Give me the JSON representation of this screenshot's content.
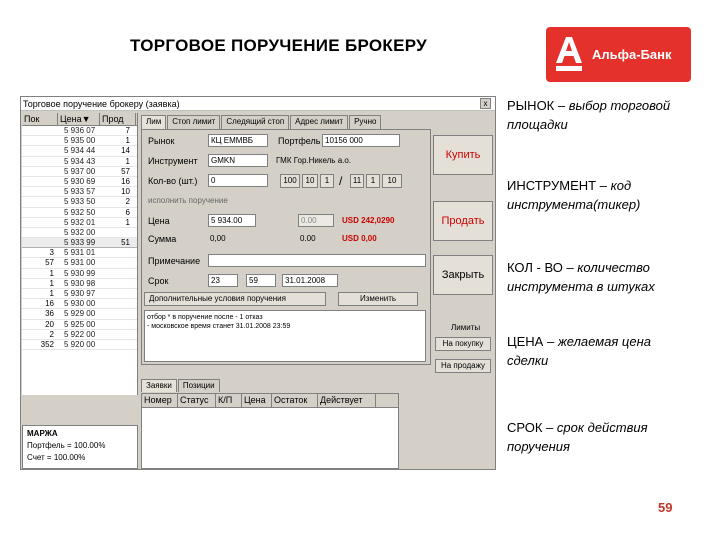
{
  "slide": {
    "title": "ТОРГОВОЕ ПОРУЧЕНИЕ БРОКЕРУ",
    "logo_text": "Альфа-Банк",
    "logo_letter": "А",
    "page_number": "59"
  },
  "window": {
    "title": "Торговое поручение брокеру (заявка)",
    "close": "x"
  },
  "quotes": {
    "headers": [
      "Пок",
      "Цена▼",
      "Прод"
    ],
    "rows": [
      [
        "",
        "5 936 07",
        "7"
      ],
      [
        "",
        "5 935 00",
        "1"
      ],
      [
        "",
        "5 934 44",
        "14"
      ],
      [
        "",
        "5 934 43",
        "1"
      ],
      [
        "",
        "5 937 00",
        "57"
      ],
      [
        "",
        "5 930 69",
        "16"
      ],
      [
        "",
        "5 933 57",
        "10"
      ],
      [
        "",
        "5 933 50",
        "2"
      ],
      [
        "",
        "5 932 50",
        "6"
      ],
      [
        "",
        "5 932 01",
        "1"
      ],
      [
        "",
        "5 932 00",
        ""
      ],
      [
        "",
        "5 933 99",
        "51"
      ],
      [
        "3",
        "5 931 01",
        ""
      ],
      [
        "57",
        "5 931 00",
        ""
      ],
      [
        "1",
        "5 930 99",
        ""
      ],
      [
        "1",
        "5 930 98",
        ""
      ],
      [
        "1",
        "5 930 97",
        ""
      ],
      [
        "16",
        "5 930 00",
        ""
      ],
      [
        "36",
        "5 929 00",
        ""
      ],
      [
        "20",
        "5 925 00",
        ""
      ],
      [
        "2",
        "5 922 00",
        ""
      ],
      [
        "352",
        "5 920 00",
        ""
      ]
    ]
  },
  "margin": {
    "label": "МАРЖА",
    "portfolio": "Портфель = 100.00%",
    "account": "Счет = 100.00%"
  },
  "tabs": [
    "Лим",
    "Стоп лимит",
    "Следящий стоп",
    "Адрес лимит",
    "Ручно"
  ],
  "form": {
    "market_label": "Рынок",
    "market_value": "КЦ ЕММВБ",
    "portfolio_label": "Портфель",
    "portfolio_value": "10156 000",
    "instrument_label": "Инструмент",
    "instrument_value": "GMKN",
    "instrument_name": "ГМК Гор.Никель а.о.",
    "qty_label": "Кол-во (шт.)",
    "qty_value": "0",
    "qty_steps": [
      "100",
      "10",
      "1",
      "/",
      "11",
      "1",
      "10"
    ],
    "checkbox_label": "исполнить поручение",
    "price_label": "Цена",
    "price_value": "5 934.00",
    "price_extra": "0.00",
    "price_usd": "USD 242,0290",
    "sum_label": "Сумма",
    "sum_value": "0,00",
    "sum_extra": "0.00",
    "sum_usd": "USD 0,00",
    "note_label": "Примечание",
    "term_label": "Срок",
    "term_hour": "23",
    "term_min": "59",
    "term_date": "31.01.2008",
    "extra_label": "Дополнительные условия поручения",
    "change_btn": "Изменить",
    "info_line1": "отбор * в поручение после - 1 отказ",
    "info_line2": "- московское время станет 31.01.2008 23:59"
  },
  "actions": {
    "buy": "Купить",
    "sell": "Продать",
    "close": "Закрыть",
    "limits_label": "Лимиты",
    "to_buy": "На покупку",
    "to_sell": "На продажу"
  },
  "orders": {
    "tabs": [
      "Заявки",
      "Позиции"
    ],
    "headers": [
      "Номер",
      "Статус",
      "К/П",
      "Цена",
      "Остаток",
      "Действует"
    ]
  },
  "bullets": [
    {
      "key": "РЫНОК",
      "text": "– выбор торговой площадки"
    },
    {
      "key": "ИНСТРУМЕНТ",
      "text": "– код инструмента(тикер)"
    },
    {
      "key": "КОЛ - ВО",
      "text": "– количество инструмента в штуках"
    },
    {
      "key": "ЦЕНА",
      "text": "– желаемая цена сделки"
    },
    {
      "key": "СРОК",
      "text": "– срок действия поручения"
    }
  ],
  "colors": {
    "brand_red": "#e4312b",
    "action_red": "#cc0000"
  }
}
